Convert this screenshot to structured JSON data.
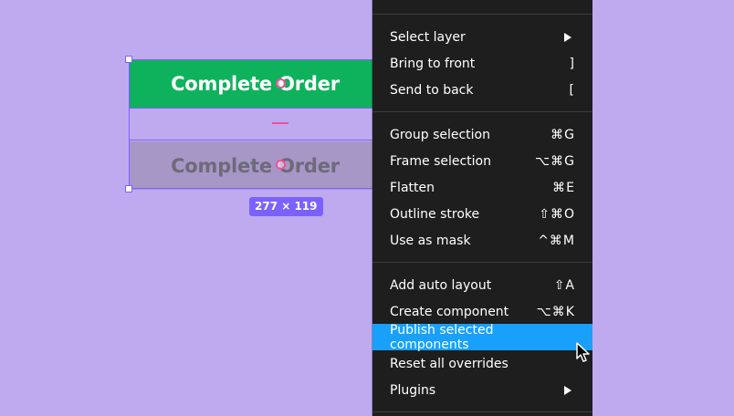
{
  "canvas": {
    "primary_button_label": "Complete Order",
    "disabled_button_label": "Complete Order",
    "dimensions_label": "277 × 119"
  },
  "colors": {
    "canvas_bg": "#bfaaf0",
    "primary": "#0fb25c",
    "disabled": "#a697c7",
    "selection": "#7b61ff",
    "menu_bg": "#1e1e1e",
    "highlight": "#18a0fb",
    "spacing_marker": "#f24e9e"
  },
  "menu": {
    "items": [
      {
        "label": "Select layer",
        "shortcut": "",
        "submenu": true
      },
      {
        "label": "Bring to front",
        "shortcut": "]"
      },
      {
        "label": "Send to back",
        "shortcut": "["
      },
      {
        "label": "Group selection",
        "shortcut": "⌘G"
      },
      {
        "label": "Frame selection",
        "shortcut": "⌥⌘G"
      },
      {
        "label": "Flatten",
        "shortcut": "⌘E"
      },
      {
        "label": "Outline stroke",
        "shortcut": "⇧⌘O"
      },
      {
        "label": "Use as mask",
        "shortcut": "^⌘M"
      },
      {
        "label": "Add auto layout",
        "shortcut": "⇧A"
      },
      {
        "label": "Create component",
        "shortcut": "⌥⌘K"
      },
      {
        "label": "Publish selected components",
        "shortcut": "",
        "highlighted": true
      },
      {
        "label": "Reset all overrides",
        "shortcut": ""
      },
      {
        "label": "Plugins",
        "shortcut": "",
        "submenu": true
      }
    ]
  }
}
